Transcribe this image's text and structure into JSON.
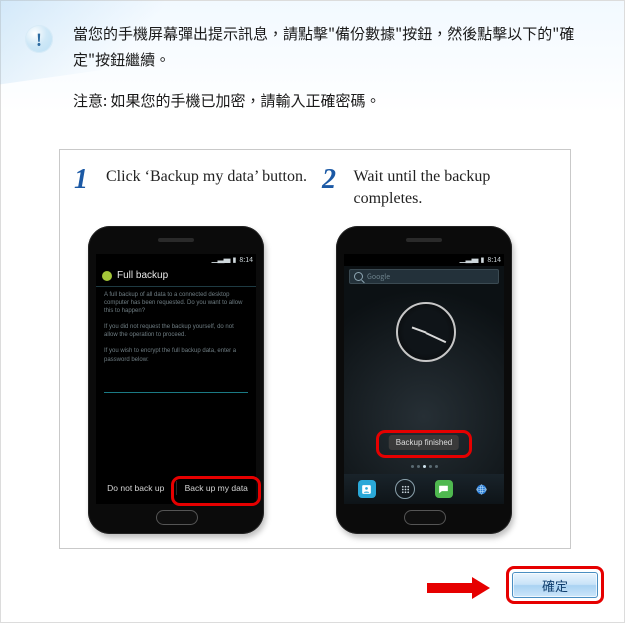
{
  "message": {
    "line": "當您的手機屏幕彈出提示訊息，請點擊\"備份數據\"按鈕，然後點擊以下的\"確定\"按鈕繼續。",
    "note": "注意: 如果您的手機已加密，請輸入正確密碼。"
  },
  "steps": {
    "one": {
      "num": "1",
      "text": "Click ‘Backup my data’ button."
    },
    "two": {
      "num": "2",
      "text": "Wait until the backup completes."
    }
  },
  "phone": {
    "status_time": "8:14",
    "backup_screen": {
      "title": "Full backup",
      "p1": "A full backup of all data to a connected desktop computer has been requested. Do you want to allow this to happen?",
      "p2": "If you did not request the backup yourself, do not allow the operation to proceed.",
      "p3": "If you wish to encrypt the full backup data, enter a password below:",
      "action_no": "Do not back up",
      "action_yes": "Back up my data"
    },
    "home_screen": {
      "search_placeholder": "Google",
      "toast": "Backup finished"
    }
  },
  "buttons": {
    "ok": "確定"
  },
  "colors": {
    "highlight": "#e60000",
    "accent": "#1b59a5"
  }
}
